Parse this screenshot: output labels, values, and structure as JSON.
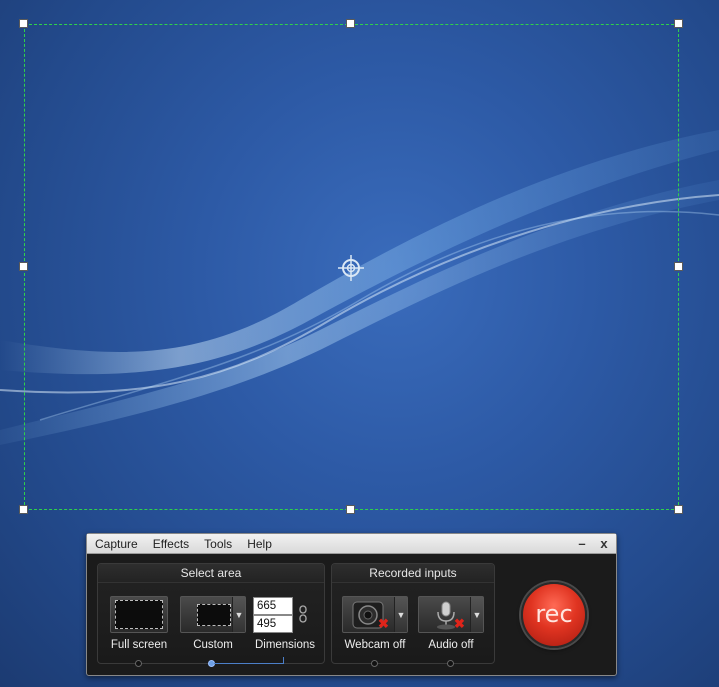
{
  "selection": {
    "move_handle_icon": "crosshair-move-icon"
  },
  "toolbar": {
    "menu": [
      "Capture",
      "Effects",
      "Tools",
      "Help"
    ],
    "minimize_label": "–",
    "close_label": "x",
    "select_area": {
      "title": "Select area",
      "full_screen_label": "Full screen",
      "custom_label": "Custom",
      "dimensions_label": "Dimensions",
      "width_value": "665",
      "height_value": "495"
    },
    "recorded_inputs": {
      "title": "Recorded inputs",
      "webcam_label": "Webcam off",
      "audio_label": "Audio off"
    },
    "rec_label": "rec"
  },
  "colors": {
    "selection_border": "#2fd24a",
    "rec_button": "#e03421",
    "slider_accent": "#4c7fc8"
  }
}
